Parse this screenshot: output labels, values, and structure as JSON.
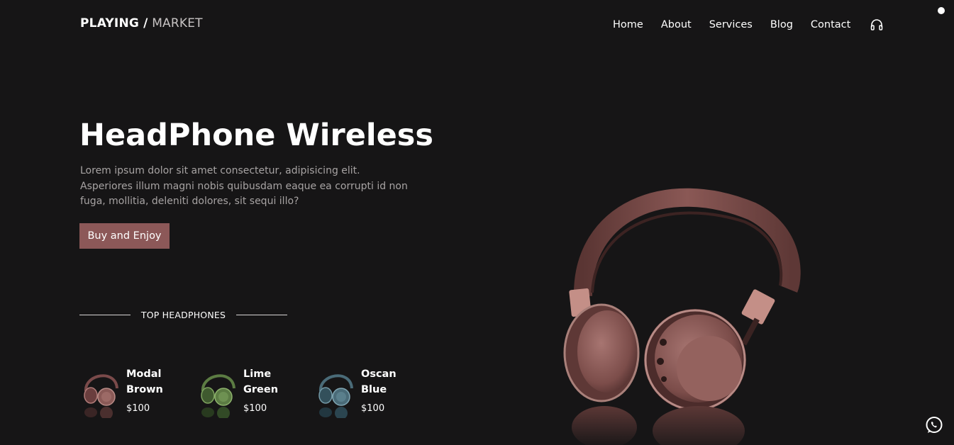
{
  "header": {
    "brand": "PLAYING /",
    "brand_sub": "MARKET",
    "nav": [
      "Home",
      "About",
      "Services",
      "Blog",
      "Contact"
    ],
    "nav_icon": "headset-icon"
  },
  "hero": {
    "title": "HeadPhone Wireless",
    "description": "Lorem ipsum dolor sit amet consectetur, adipisicing elit. Asperiores illum magni nobis quibusdam eaque ea corrupti id non fuga, mollitia, deleniti dolores, sit sequi illo?",
    "button": "Buy and Enjoy"
  },
  "top": {
    "label": "TOP HEADPHONES",
    "products": [
      {
        "name": "Modal Brown",
        "price": "$100",
        "color": "#7a4a4a"
      },
      {
        "name": "Lime Green",
        "price": "$100",
        "color": "#5c7c43"
      },
      {
        "name": "Oscan Blue",
        "price": "$100",
        "color": "#4a6b78"
      }
    ]
  },
  "colors": {
    "background": "#161516",
    "accent": "#8c5858",
    "headphone": "#8a5a57"
  },
  "floating": {
    "icon": "whatsapp-icon"
  }
}
